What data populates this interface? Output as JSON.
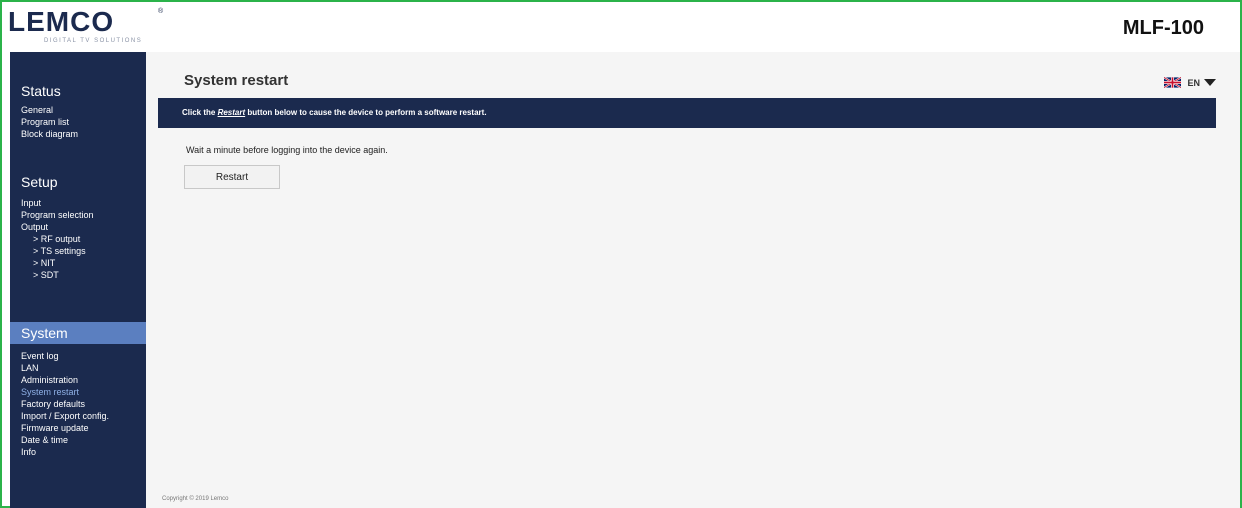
{
  "header": {
    "logo_text": "LEMCO",
    "logo_reg": "®",
    "logo_tagline": "DIGITAL TV SOLUTIONS",
    "model": "MLF-100"
  },
  "sidebar": {
    "status": {
      "title": "Status",
      "items": [
        "General",
        "Program list",
        "Block diagram"
      ]
    },
    "setup": {
      "title": "Setup",
      "items": [
        "Input",
        "Program selection",
        "Output",
        "> RF output",
        "> TS settings",
        "> NIT",
        "> SDT"
      ]
    },
    "system": {
      "title": "System",
      "items": [
        "Event log",
        "LAN",
        "Administration",
        "System restart",
        "Factory defaults",
        "Import / Export config.",
        "Firmware update",
        "Date & time",
        "Info"
      ]
    }
  },
  "main": {
    "title": "System restart",
    "language": {
      "label": "EN",
      "flag_icon": "uk-flag-icon"
    },
    "banner": {
      "before": "Click the ",
      "emph": "Restart",
      "after": " button below to cause the device to perform a software restart."
    },
    "info_text": "Wait a minute before logging into the device again.",
    "restart_label": "Restart",
    "copyright": "Copyright © 2019 Lemco"
  },
  "colors": {
    "navy": "#1b2a4e",
    "active_section": "#5b7fc0",
    "frame_border": "#2bb34a",
    "current_item": "#8fb0e6"
  }
}
